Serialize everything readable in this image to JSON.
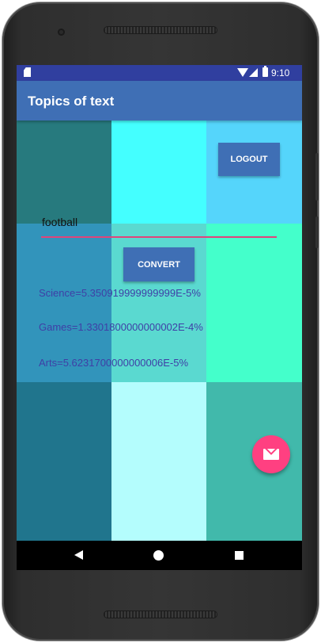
{
  "status_bar": {
    "time": "9:10"
  },
  "app_bar": {
    "title": "Topics of text"
  },
  "tiles": [
    {
      "color": "#277a7e"
    },
    {
      "color": "#44ffff"
    },
    {
      "color": "#55d5fb"
    },
    {
      "color": "#3294bb"
    },
    {
      "color": "#5ad9d0"
    },
    {
      "color": "#44ffcb"
    },
    {
      "color": "#20758d"
    },
    {
      "color": "#b4fdfd"
    },
    {
      "color": "#41b9ab"
    }
  ],
  "buttons": {
    "logout_label": "LOGOUT",
    "convert_label": "CONVERT"
  },
  "input": {
    "value": "football"
  },
  "results": [
    "Science=5.350919999999999E-5%",
    "Games=1.3301800000000002E-4%",
    "Arts=5.6231700000000006E-5%"
  ],
  "colors": {
    "accent": "#ff4081",
    "primary": "#3f6fb5",
    "status_bar": "#303f9f"
  },
  "icons": {
    "fab": "mail-icon"
  }
}
